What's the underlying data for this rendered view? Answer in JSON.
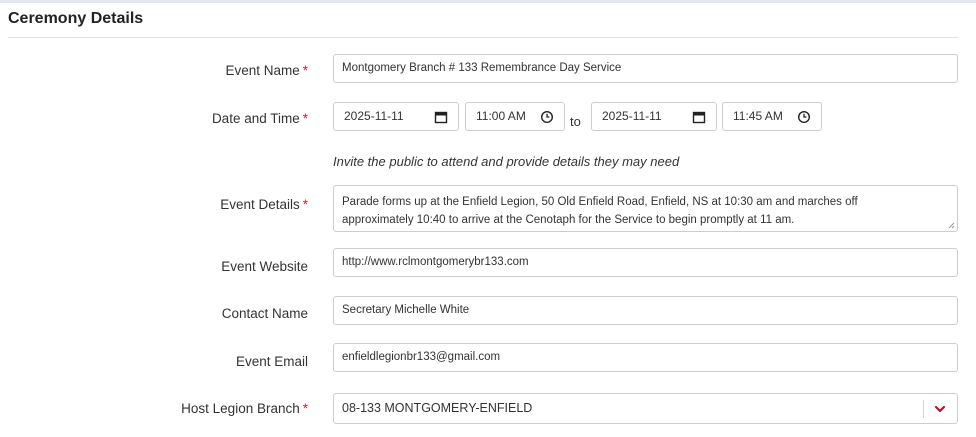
{
  "section": {
    "title": "Ceremony Details"
  },
  "fields": {
    "event_name": {
      "label": "Event Name",
      "required": "*",
      "value": "Montgomery Branch # 133 Remembrance Day Service"
    },
    "date_time": {
      "label": "Date and Time",
      "required": "*",
      "start_date": "2025-11-11",
      "start_time": "11:00 AM",
      "to": "to",
      "end_date": "2025-11-11",
      "end_time": "11:45 AM"
    },
    "hint": "Invite the public to attend and provide details they may need",
    "event_details": {
      "label": "Event Details",
      "required": "*",
      "line1": "Parade forms up at the Enfield Legion, 50 Old Enfield Road, Enfield, NS at 10:30 am and marches off",
      "line2": "approximately 10:40 to arrive at the Cenotaph for the Service to begin promptly at 11 am."
    },
    "event_website": {
      "label": "Event Website",
      "value": "http://www.rclmontgomerybr133.com"
    },
    "contact_name": {
      "label": "Contact Name",
      "value": "Secretary Michelle White"
    },
    "event_email": {
      "label": "Event Email",
      "value": "enfieldlegionbr133@gmail.com"
    },
    "host_branch": {
      "label": "Host Legion Branch",
      "required": "*",
      "value": "08-133 MONTGOMERY-ENFIELD"
    }
  },
  "colors": {
    "required": "#d2202f",
    "chevron": "#c0122a",
    "border": "#c9ced6"
  },
  "icons": {
    "date": "calendar-icon",
    "time": "clock-icon",
    "dropdown": "chevron-down-icon"
  }
}
